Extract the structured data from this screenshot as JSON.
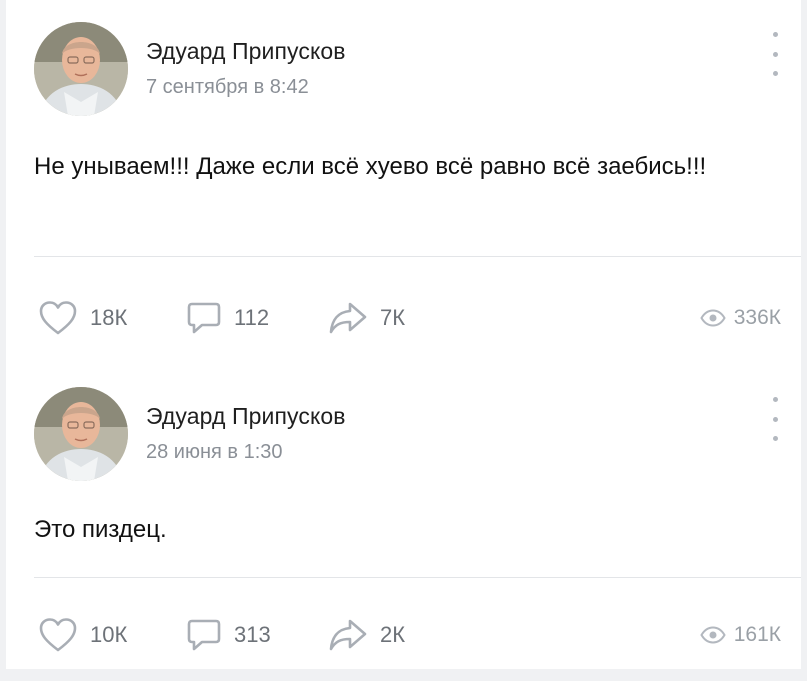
{
  "colors": {
    "text": "#111111",
    "muted": "#8a8f96",
    "icon": "#a9aeb5",
    "divider": "#e3e5e8"
  },
  "posts": [
    {
      "author": "Эдуард Припусков",
      "date": "7 сентября в 8:42",
      "text": "Не унываем!!! Даже если всё хуево всё равно всё заебись!!!",
      "likes": "18К",
      "comments": "112",
      "shares": "7К",
      "views": "336К",
      "icons": {
        "like": "heart-icon",
        "comment": "comment-icon",
        "share": "share-arrow-icon",
        "views": "eye-icon",
        "menu": "more-vertical-icon"
      }
    },
    {
      "author": "Эдуард Припусков",
      "date": "28 июня в 1:30",
      "text": "Это пиздец.",
      "likes": "10К",
      "comments": "313",
      "shares": "2К",
      "views": "161К",
      "icons": {
        "like": "heart-icon",
        "comment": "comment-icon",
        "share": "share-arrow-icon",
        "views": "eye-icon",
        "menu": "more-vertical-icon"
      }
    }
  ]
}
